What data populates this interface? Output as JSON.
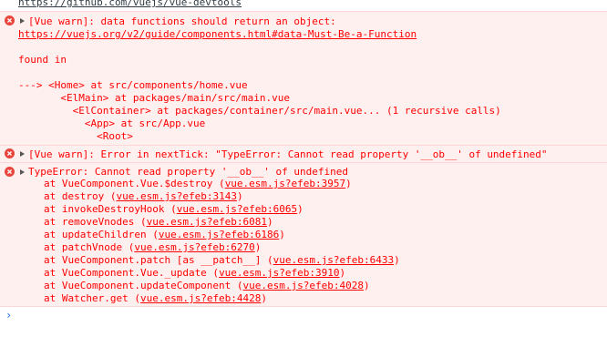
{
  "top_link": "https://github.com/vuejs/vue-devtools",
  "warn1": {
    "message": "[Vue warn]: data functions should return an object:",
    "link": "https://vuejs.org/v2/guide/components.html#data-Must-Be-a-Function",
    "found_in": "found in",
    "trace": [
      "---> <Home> at src/components/home.vue",
      "       <ElMain> at packages/main/src/main.vue",
      "         <ElContainer> at packages/container/src/main.vue... (1 recursive calls)",
      "           <App> at src/App.vue",
      "             <Root>"
    ]
  },
  "warn2": {
    "message": "[Vue warn]: Error in nextTick: \"TypeError: Cannot read property '__ob__' of undefined\""
  },
  "error": {
    "message": "TypeError: Cannot read property '__ob__' of undefined",
    "stack": [
      {
        "fn": "at VueComponent.Vue.$destroy (",
        "loc": "vue.esm.js?efeb:3957",
        "end": ")"
      },
      {
        "fn": "at destroy (",
        "loc": "vue.esm.js?efeb:3143",
        "end": ")"
      },
      {
        "fn": "at invokeDestroyHook (",
        "loc": "vue.esm.js?efeb:6065",
        "end": ")"
      },
      {
        "fn": "at removeVnodes (",
        "loc": "vue.esm.js?efeb:6081",
        "end": ")"
      },
      {
        "fn": "at updateChildren (",
        "loc": "vue.esm.js?efeb:6186",
        "end": ")"
      },
      {
        "fn": "at patchVnode (",
        "loc": "vue.esm.js?efeb:6270",
        "end": ")"
      },
      {
        "fn": "at VueComponent.patch [as __patch__] (",
        "loc": "vue.esm.js?efeb:6433",
        "end": ")"
      },
      {
        "fn": "at VueComponent.Vue._update (",
        "loc": "vue.esm.js?efeb:3910",
        "end": ")"
      },
      {
        "fn": "at VueComponent.updateComponent (",
        "loc": "vue.esm.js?efeb:4028",
        "end": ")"
      },
      {
        "fn": "at Watcher.get (",
        "loc": "vue.esm.js?efeb:4428",
        "end": ")"
      }
    ]
  },
  "prompt_symbol": "›",
  "colors": {
    "error_text": "#ff0000",
    "error_bg": "#fff0f0",
    "error_border": "#ffd6d6",
    "prompt": "#1a73e8"
  },
  "icons": {
    "error": "error-circle-icon",
    "expand": "expand-triangle-icon"
  }
}
